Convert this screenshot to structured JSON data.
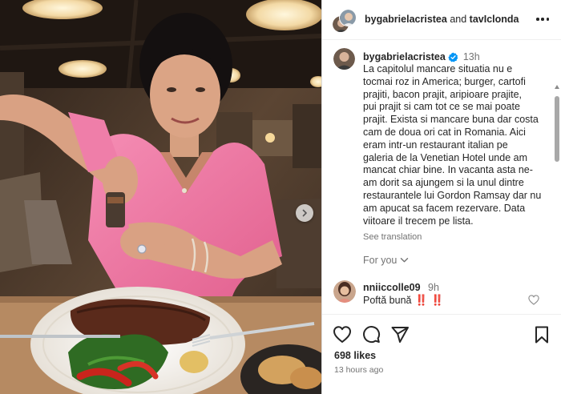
{
  "post": {
    "author": "bygabrielacristea",
    "collaborator": "tavIclonda",
    "connector": "and",
    "more_icon": "more-horizontal-icon"
  },
  "caption": {
    "username": "bygabrielacristea",
    "verified": true,
    "time_ago": "13h",
    "lines": [
      "La capitolul mancare situatia nu e",
      "tocmai roz in America; burger, cartofi",
      "prajiti, bacon prajit, aripioare prajite,",
      "pui prajit si cam tot ce se mai poate",
      "prajit. Exista si mancare buna dar costa",
      "cam de doua ori cat in Romania. Aici",
      "eram intr-un restaurant italian pe",
      "galeria de la Venetian Hotel unde am",
      "mancat chiar bine. In vacanta asta ne-",
      "am dorit sa ajungem si la unul dintre",
      "restaurantele lui Gordon Ramsay dar nu",
      "am apucat sa facem rezervare. Data",
      "viitoare il trecem pe lista."
    ],
    "see_translation": "See translation"
  },
  "for_you": "For you",
  "comment": {
    "username": "nniiccolle09",
    "time_ago": "9h",
    "text": "Poftă bună",
    "emoji": [
      "‼️",
      "‼️"
    ]
  },
  "actions": {
    "likes": "698 likes",
    "posted": "13 hours ago"
  },
  "colors": {
    "verified_blue": "#0095f6",
    "text_primary": "#262626",
    "text_secondary": "#737373",
    "border": "#dbdbdb",
    "exclamation_red": "#e5203a",
    "shirt_pink": "#f07aa6"
  }
}
